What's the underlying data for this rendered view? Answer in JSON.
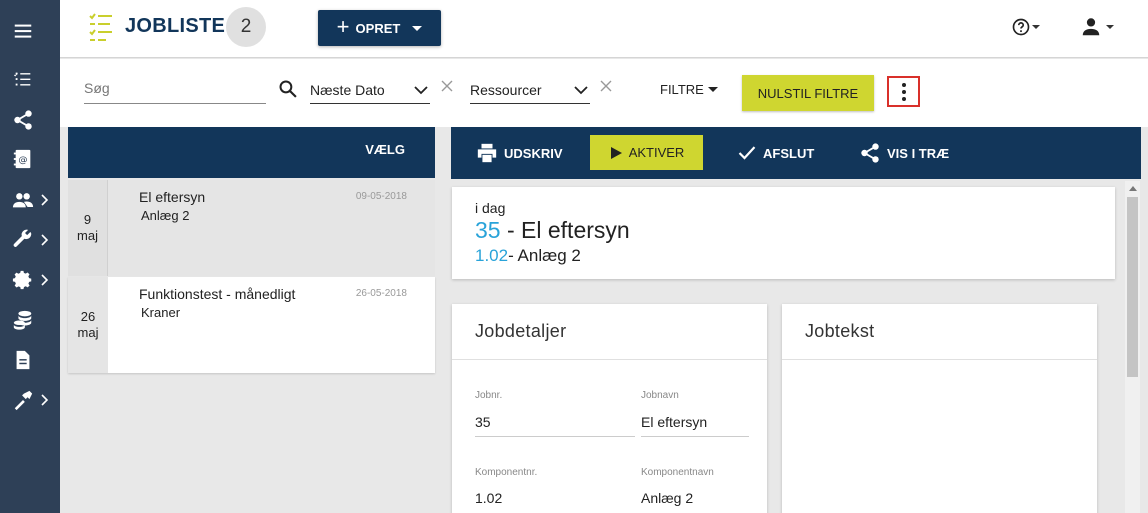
{
  "app": {
    "title": "JOBLISTE",
    "count": "2"
  },
  "toolbar": {
    "create_label": "OPRET"
  },
  "rail": {
    "items": [
      {
        "icon": "menu-icon"
      },
      {
        "icon": "checklist-icon"
      },
      {
        "icon": "share-icon"
      },
      {
        "icon": "contacts-icon"
      },
      {
        "icon": "users-icon"
      },
      {
        "icon": "wrench-icon"
      },
      {
        "icon": "gear-icon"
      },
      {
        "icon": "database-icon"
      },
      {
        "icon": "document-icon"
      },
      {
        "icon": "tools-icon"
      }
    ]
  },
  "filters": {
    "search_placeholder": "Søg",
    "date_select": "Næste Dato",
    "resource_select": "Ressourcer",
    "filter_label": "FILTRE",
    "reset_label": "NULSTIL FILTRE"
  },
  "list": {
    "header_label": "VÆLG",
    "items": [
      {
        "day": "9",
        "month": "maj",
        "title": "El eftersyn",
        "sub": "Anlæg 2",
        "date": "09-05-2018"
      },
      {
        "day": "26",
        "month": "maj",
        "title": "Funktionstest - månedligt",
        "sub": "Kraner",
        "date": "26-05-2018"
      }
    ]
  },
  "actions": {
    "print": "UDSKRIV",
    "activate": "AKTIVER",
    "finish": "AFSLUT",
    "tree": "VIS I TRÆ"
  },
  "summary": {
    "when": "i dag",
    "job_no": "35",
    "job_sep": "- El eftersyn",
    "comp_no": "1.02",
    "comp_sep": "- Anlæg 2"
  },
  "details": {
    "title": "Jobdetaljer",
    "jobnr_label": "Jobnr.",
    "jobnr": "35",
    "jobnavn_label": "Jobnavn",
    "jobnavn": "El eftersyn",
    "komponentnr_label": "Komponentnr.",
    "komponentnr": "1.02",
    "komponentnavn_label": "Komponentnavn",
    "komponentnavn": "Anlæg 2"
  },
  "jobtext": {
    "title": "Jobtekst"
  },
  "colors": {
    "navy": "#12365a",
    "rail": "#2e4057",
    "lime": "#cfd630",
    "link_blue": "#29a3d9",
    "highlight_red": "#d9302a"
  }
}
